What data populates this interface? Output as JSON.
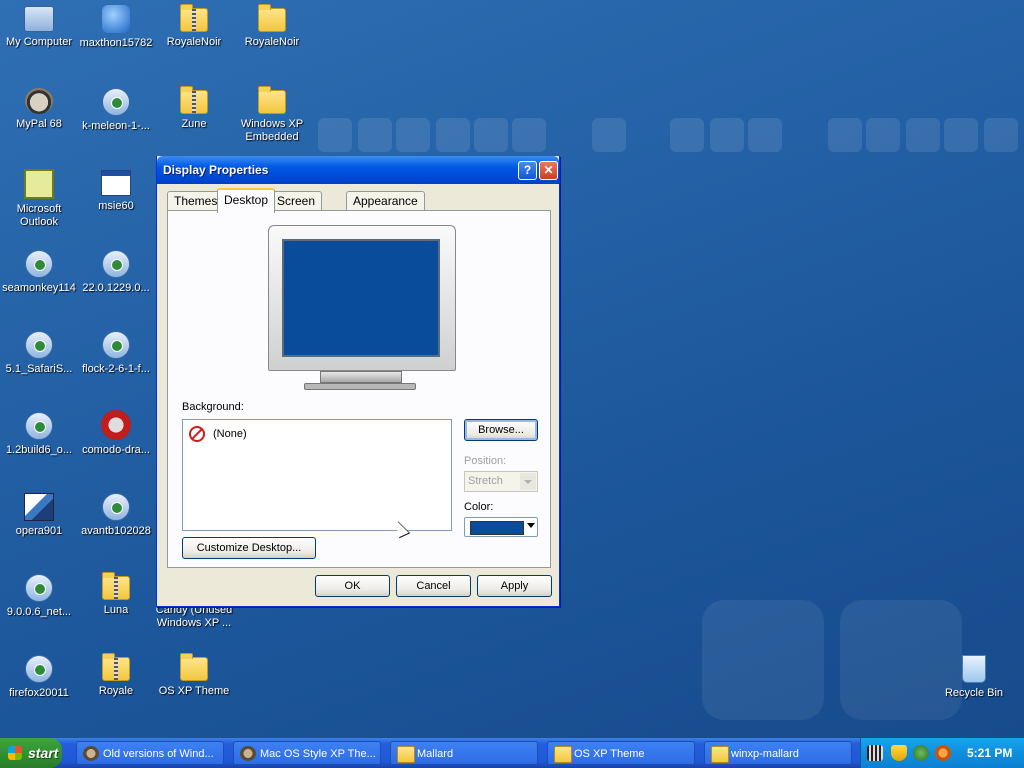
{
  "desktop": {
    "icons": [
      {
        "label": "My Computer",
        "icon": "computer-icon"
      },
      {
        "label": "maxthon15782",
        "icon": "maxthon-icon"
      },
      {
        "label": "RoyaleNoir",
        "icon": "zip-folder-icon"
      },
      {
        "label": "RoyaleNoir",
        "icon": "folder-icon"
      },
      {
        "label": "MyPal 68",
        "icon": "raccoon-icon"
      },
      {
        "label": "k-meleon-1-...",
        "icon": "installer-icon"
      },
      {
        "label": "Zune",
        "icon": "zip-folder-icon"
      },
      {
        "label": "Windows XP\nEmbedded",
        "icon": "folder-icon"
      },
      {
        "label": "Microsoft\nOutlook",
        "icon": "outlook-icon"
      },
      {
        "label": "msie60",
        "icon": "window-icon"
      },
      {
        "label": "seamonkey114",
        "icon": "installer-icon"
      },
      {
        "label": "22.0.1229.0...",
        "icon": "installer-icon"
      },
      {
        "label": "5.1_SafariS...",
        "icon": "installer-icon"
      },
      {
        "label": "flock-2-6-1-f...",
        "icon": "installer-icon"
      },
      {
        "label": "1.2build6_o...",
        "icon": "installer-icon"
      },
      {
        "label": "comodo-dra...",
        "icon": "comodo-icon"
      },
      {
        "label": "opera901",
        "icon": "opera-icon"
      },
      {
        "label": "avantb102028",
        "icon": "installer-icon"
      },
      {
        "label": "9.0.0.6_net...",
        "icon": "installer-icon"
      },
      {
        "label": "Luna",
        "icon": "zip-folder-icon"
      },
      {
        "label": "Candy (Unused\nWindows XP ...",
        "icon": "folder-icon"
      },
      {
        "label": "firefox20011",
        "icon": "installer-icon"
      },
      {
        "label": "Royale",
        "icon": "zip-folder-icon"
      },
      {
        "label": "OS XP Theme",
        "icon": "folder-icon"
      },
      {
        "label": "Recycle Bin",
        "icon": "recycle-bin-icon"
      }
    ]
  },
  "dialog": {
    "title": "Display Properties",
    "help_glyph": "?",
    "close_glyph": "✕",
    "tabs": [
      {
        "label": "Themes"
      },
      {
        "label": "Desktop"
      },
      {
        "label": "Screen Saver"
      },
      {
        "label": "Appearance"
      }
    ],
    "active_tab": "Desktop",
    "background_label": "Background:",
    "background_items": [
      {
        "label": "(None)"
      }
    ],
    "browse_label": "Browse...",
    "position_label": "Position:",
    "position_value": "Stretch",
    "color_label": "Color:",
    "color_value": "#0a4c9c",
    "customize_label": "Customize Desktop...",
    "ok_label": "OK",
    "cancel_label": "Cancel",
    "apply_label": "Apply"
  },
  "taskbar": {
    "start_label": "start",
    "tasks": [
      {
        "label": "Old versions of Wind...",
        "icon": "app-icon"
      },
      {
        "label": "Mac OS Style XP The...",
        "icon": "app-icon"
      },
      {
        "label": "Mallard",
        "icon": "folder-icon"
      },
      {
        "label": "OS XP Theme",
        "icon": "folder-icon"
      },
      {
        "label": "winxp-mallard",
        "icon": "folder-icon"
      }
    ],
    "clock": "5:21 PM"
  }
}
